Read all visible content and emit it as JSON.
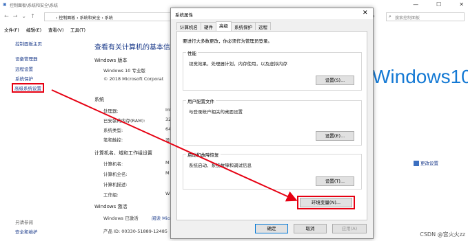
{
  "window": {
    "title": "控制面板\\系统和安全\\系统",
    "controls": [
      "—",
      "☐",
      "✕"
    ]
  },
  "address": {
    "path": "›  控制面板  ›  系统和安全  ›  系统",
    "search_placeholder": "搜索控制面板"
  },
  "menu": [
    "文件(F)",
    "编辑(E)",
    "查看(V)",
    "工具(T)"
  ],
  "sidebar": {
    "home": "控制面板主页",
    "items": [
      "设备管理器",
      "远程设置",
      "系统保护",
      "高级系统设置"
    ],
    "see_also": "另请参阅",
    "security": "安全和维护"
  },
  "main": {
    "heading": "查看有关计算机的基本信息",
    "edition_section": "Windows 版本",
    "edition": "Windows 10 专业版",
    "copyright": "© 2018 Microsoft Corporat",
    "win10_logo": "Windows10",
    "system_section": "系统",
    "system_rows": [
      {
        "label": "处理器:",
        "value": "Int"
      },
      {
        "label": "已安装的内存(RAM):",
        "value": "32"
      },
      {
        "label": "系统类型:",
        "value": "64"
      },
      {
        "label": "笔和触控:",
        "value": "没"
      }
    ],
    "computer_section": "计算机名、域和工作组设置",
    "computer_rows": [
      {
        "label": "计算机名:",
        "value": "M"
      },
      {
        "label": "计算机全名:",
        "value": "M"
      },
      {
        "label": "计算机描述:",
        "value": ""
      },
      {
        "label": "工作组:",
        "value": "W"
      }
    ],
    "change_settings": "更改设置",
    "activation_section": "Windows 激活",
    "activation_status": "Windows 已激活",
    "activation_link": "阅读 Micro",
    "product_id": "产品 ID: 00330-51889-12485"
  },
  "dialog": {
    "title": "系统属性",
    "close": "✕",
    "tabs": [
      "计算机名",
      "硬件",
      "高级",
      "系统保护",
      "远程"
    ],
    "active_tab": "高级",
    "admin_note": "要进行大多数更改，你必须作为管理员登录。",
    "groups": [
      {
        "title": "性能",
        "desc": "视觉效果，处理器计划，内存使用，以及虚拟内存",
        "button": "设置(S)..."
      },
      {
        "title": "用户配置文件",
        "desc": "与登录帐户相关的桌面设置",
        "button": "设置(E)..."
      },
      {
        "title": "启动和故障恢复",
        "desc": "系统启动、系统故障和调试信息",
        "button": "设置(T)..."
      }
    ],
    "env_button": "环境变量(N)...",
    "ok": "确定",
    "cancel": "取消",
    "apply": "应用(A)"
  },
  "watermark": "CSDN @宫火火zz",
  "colors": {
    "highlight": "#e60012",
    "link": "#1a3a8a",
    "win10": "#1479d4"
  }
}
